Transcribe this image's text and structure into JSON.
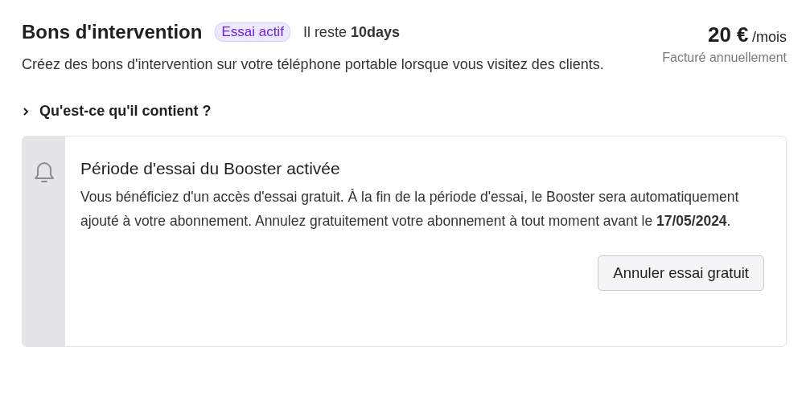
{
  "header": {
    "title": "Bons d'intervention",
    "badge": "Essai actif",
    "remaining": "Il reste **10days**",
    "description": "Créez des bons d'intervention sur votre téléphone portable lorsque vous visitez des clients."
  },
  "price": {
    "amount": "20 €",
    "period": "/mois",
    "billing": "Facturé annuellement"
  },
  "expander": {
    "label": "Qu'est-ce qu'il contient ?",
    "expanded": false
  },
  "notice": {
    "title": "Période d'essai du Booster activée",
    "body": "Vous bénéficiez d'un accès d'essai gratuit. À la fin de la période d'essai, le Booster sera automatiquement ajouté à votre abonnement. Annulez gratuitement votre abonnement à tout moment avant le **17/05/2024**.",
    "button": "Annuler essai gratuit"
  }
}
